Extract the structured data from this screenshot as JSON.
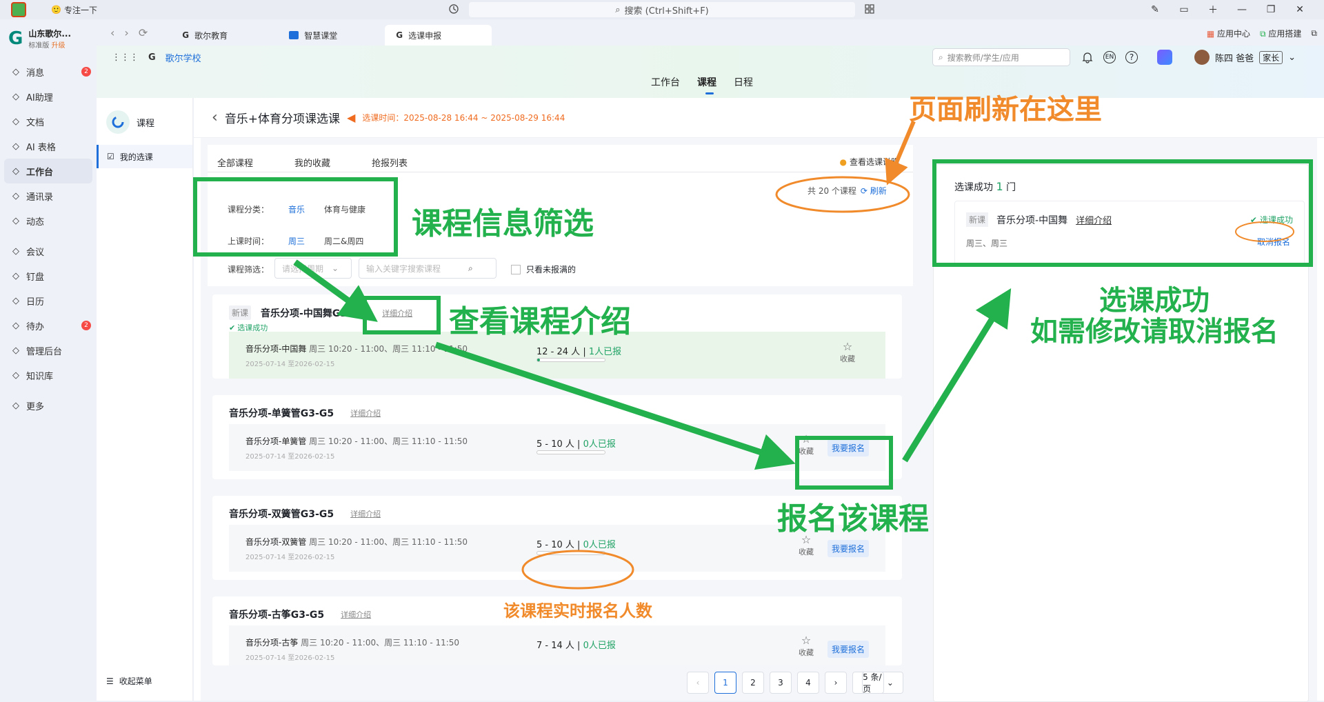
{
  "titlebar": {
    "status": "专注一下",
    "search_placeholder": "搜索 (Ctrl+Shift+F)"
  },
  "org": {
    "name": "山东歌尔...",
    "edition": "标准版",
    "upgrade": "升级"
  },
  "nav": [
    {
      "label": "消息",
      "icon": "message-icon",
      "badge": "2"
    },
    {
      "label": "AI助理",
      "icon": "ai-assistant-icon"
    },
    {
      "label": "文档",
      "icon": "document-icon"
    },
    {
      "label": "AI 表格",
      "icon": "ai-table-icon"
    },
    {
      "label": "工作台",
      "icon": "workbench-icon",
      "active": true
    },
    {
      "label": "通讯录",
      "icon": "contacts-icon"
    },
    {
      "label": "动态",
      "icon": "activity-icon"
    },
    {
      "label": "会议",
      "icon": "meeting-icon"
    },
    {
      "label": "钉盘",
      "icon": "drive-icon"
    },
    {
      "label": "日历",
      "icon": "calendar-icon"
    },
    {
      "label": "待办",
      "icon": "todo-icon",
      "badge": "2"
    },
    {
      "label": "管理后台",
      "icon": "admin-icon"
    },
    {
      "label": "知识库",
      "icon": "knowledge-icon"
    },
    {
      "label": "更多",
      "icon": "more-icon"
    }
  ],
  "browser_tabs": [
    "歌尔教育",
    "智慧课堂",
    "选课申报"
  ],
  "top_right": {
    "app_center": "应用中心",
    "app_build": "应用搭建"
  },
  "app": {
    "school": "歌尔学校",
    "menu": [
      "工作台",
      "课程",
      "日程"
    ],
    "search_placeholder": "搜索教师/学生/应用",
    "user": "陈四 爸爸",
    "role": "家长"
  },
  "module": {
    "title": "课程",
    "item": "我的选课",
    "collapse": "收起菜单"
  },
  "page": {
    "title": "音乐+体育分项课选课",
    "time": "选课时间：2025-08-28 16:44 ~ 2025-08-29 16:44"
  },
  "tabs": [
    "全部课程",
    "我的收藏",
    "抢报列表"
  ],
  "help_text": "查看选课说明",
  "filters": {
    "category_label": "课程分类：",
    "categories": [
      "音乐",
      "体育与健康"
    ],
    "time_label": "上课时间：",
    "times": [
      "周三",
      "周二&周四"
    ],
    "filter_label": "课程筛选：",
    "cycle_placeholder": "请选择周期",
    "keyword_placeholder": "输入关键字搜索课程",
    "only_unfull": "只看未报满的"
  },
  "count": {
    "text": "共 20 个课程",
    "refresh": "刷新"
  },
  "courses": [
    {
      "new": "新课",
      "title": "音乐分项-中国舞G3-G5",
      "detail": "详细介绍",
      "status": "选课成功",
      "name": "音乐分项-中国舞",
      "schedule": "周三 10:20 - 11:00、周三 11:10 - 11:50",
      "dates": "2025-07-14 至2026-02-15",
      "capacity": "12 - 24 人",
      "enrolled": "1人已报",
      "fill": 0.04,
      "fav": "收藏"
    },
    {
      "title": "音乐分项-单簧管G3-G5",
      "detail": "详细介绍",
      "name": "音乐分项-单簧管",
      "schedule": "周三 10:20 - 11:00、周三 11:10 - 11:50",
      "dates": "2025-07-14 至2026-02-15",
      "capacity": "5 - 10 人",
      "enrolled": "0人已报",
      "fill": 0,
      "fav": "收藏",
      "enroll": "我要报名"
    },
    {
      "title": "音乐分项-双簧管G3-G5",
      "detail": "详细介绍",
      "name": "音乐分项-双簧管",
      "schedule": "周三 10:20 - 11:00、周三 11:10 - 11:50",
      "dates": "2025-07-14 至2026-02-15",
      "capacity": "5 - 10 人",
      "enrolled": "0人已报",
      "fill": 0,
      "fav": "收藏",
      "enroll": "我要报名"
    },
    {
      "title": "音乐分项-古筝G3-G5",
      "detail": "详细介绍",
      "name": "音乐分项-古筝",
      "schedule": "周三 10:20 - 11:00、周三 11:10 - 11:50",
      "dates": "2025-07-14 至2026-02-15",
      "capacity": "7 - 14 人",
      "enrolled": "0人已报",
      "fill": 0,
      "fav": "收藏",
      "enroll": "我要报名"
    }
  ],
  "pagination": {
    "pages": [
      "1",
      "2",
      "3",
      "4"
    ],
    "current": "1",
    "size": "5 条/页"
  },
  "selected": {
    "label": "选课成功",
    "count": "1",
    "unit": "门",
    "new": "新课",
    "name": "音乐分项-中国舞",
    "detail": "详细介绍",
    "status": "选课成功",
    "days": "周三、周三",
    "cancel": "取消报名"
  },
  "annotations": {
    "refresh_note": "页面刷新在这里",
    "filter_note": "课程信息筛选",
    "detail_note": "查看课程介绍",
    "enroll_note": "报名该课程",
    "success_note_1": "选课成功",
    "success_note_2": "如需修改请取消报名",
    "realtime_note": "该课程实时报名人数"
  },
  "colors": {
    "green": "#22b14c",
    "orange": "#f08a2a",
    "blue": "#1e6fd9"
  }
}
